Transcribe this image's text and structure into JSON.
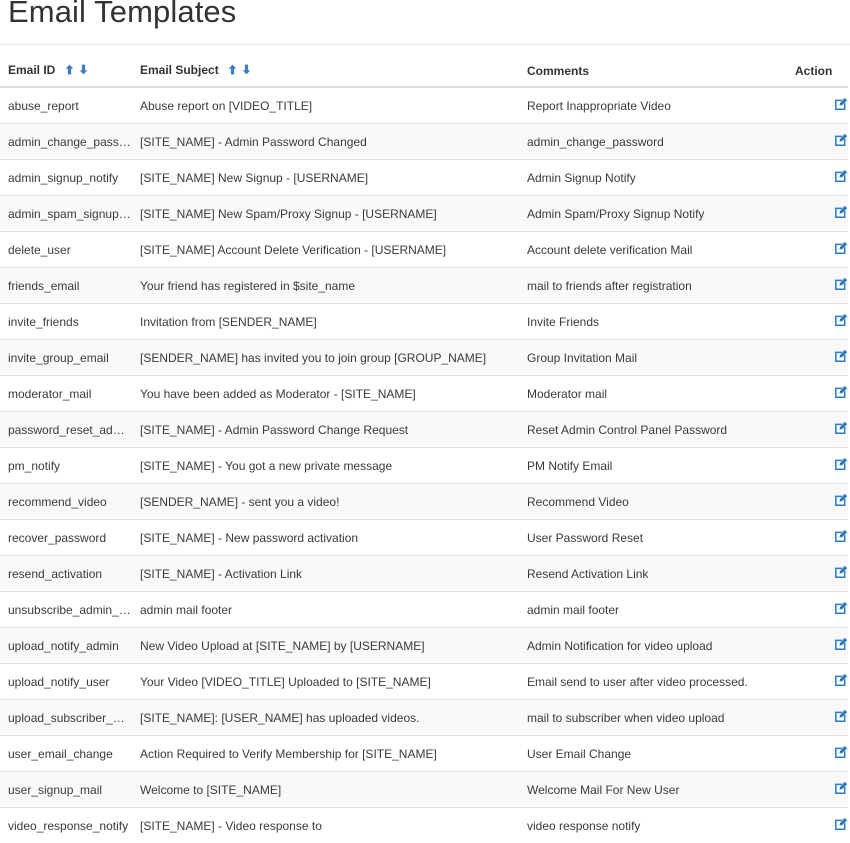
{
  "page": {
    "title": "Email Templates"
  },
  "colors": {
    "accent": "#3b7ebf",
    "icon_blue": "#2d7bbd",
    "text": "#333333",
    "row_stripe": "#f9f9f9",
    "border": "#e4e4e4"
  },
  "table": {
    "columns": [
      {
        "key": "email_id",
        "label": "Email ID",
        "sortable": true
      },
      {
        "key": "email_subject",
        "label": "Email Subject",
        "sortable": true
      },
      {
        "key": "comments",
        "label": "Comments",
        "sortable": false
      },
      {
        "key": "action",
        "label": "Action",
        "sortable": false
      }
    ],
    "sort_icons": {
      "asc": "arrow-up-icon",
      "desc": "arrow-down-icon"
    },
    "action_icon": "edit-square-icon",
    "rows": [
      {
        "email_id": "abuse_report",
        "email_subject": "Abuse report on [VIDEO_TITLE]",
        "comments": "Report Inappropriate Video"
      },
      {
        "email_id": "admin_change_password",
        "email_subject": "[SITE_NAME] - Admin Password Changed",
        "comments": "admin_change_password"
      },
      {
        "email_id": "admin_signup_notify",
        "email_subject": "[SITE_NAME] New Signup - [USERNAME]",
        "comments": "Admin Signup Notify"
      },
      {
        "email_id": "admin_spam_signup_notify",
        "email_subject": "[SITE_NAME] New Spam/Proxy Signup - [USERNAME]",
        "comments": "Admin Spam/Proxy Signup Notify"
      },
      {
        "email_id": "delete_user",
        "email_subject": "[SITE_NAME] Account Delete Verification - [USERNAME]",
        "comments": "Account delete verification Mail"
      },
      {
        "email_id": "friends_email",
        "email_subject": "Your friend has registered in $site_name",
        "comments": "mail to friends after registration"
      },
      {
        "email_id": "invite_friends",
        "email_subject": "Invitation from [SENDER_NAME]",
        "comments": "Invite Friends"
      },
      {
        "email_id": "invite_group_email",
        "email_subject": "[SENDER_NAME] has invited you to join group [GROUP_NAME]",
        "comments": "Group Invitation Mail"
      },
      {
        "email_id": "moderator_mail",
        "email_subject": "You have been added as Moderator - [SITE_NAME]",
        "comments": "Moderator mail"
      },
      {
        "email_id": "password_reset_admin",
        "email_subject": "[SITE_NAME] - Admin Password Change Request",
        "comments": "Reset Admin Control Panel Password"
      },
      {
        "email_id": "pm_notify",
        "email_subject": "[SITE_NAME] - You got a new private message",
        "comments": "PM Notify Email"
      },
      {
        "email_id": "recommend_video",
        "email_subject": "[SENDER_NAME] - sent you a video!",
        "comments": "Recommend Video"
      },
      {
        "email_id": "recover_password",
        "email_subject": "[SITE_NAME] - New password activation",
        "comments": "User Password Reset"
      },
      {
        "email_id": "resend_activation",
        "email_subject": "[SITE_NAME] - Activation Link",
        "comments": "Resend Activation Link"
      },
      {
        "email_id": "unsubscribe_admin_mail",
        "email_subject": "admin mail footer",
        "comments": "admin mail footer"
      },
      {
        "email_id": "upload_notify_admin",
        "email_subject": "New Video Upload at [SITE_NAME] by [USERNAME]",
        "comments": "Admin Notification for video upload"
      },
      {
        "email_id": "upload_notify_user",
        "email_subject": "Your Video [VIDEO_TITLE] Uploaded to [SITE_NAME]",
        "comments": "Email send to user after video processed."
      },
      {
        "email_id": "upload_subscriber_mail",
        "email_subject": "[SITE_NAME]: [USER_NAME] has uploaded videos.",
        "comments": "mail to subscriber when video upload"
      },
      {
        "email_id": "user_email_change",
        "email_subject": "Action Required to Verify Membership for [SITE_NAME]",
        "comments": "User Email Change"
      },
      {
        "email_id": "user_signup_mail",
        "email_subject": "Welcome to [SITE_NAME]",
        "comments": "Welcome Mail For New User"
      },
      {
        "email_id": "video_response_notify",
        "email_subject": "[SITE_NAME] - Video response to",
        "comments": "video response notify"
      }
    ]
  }
}
